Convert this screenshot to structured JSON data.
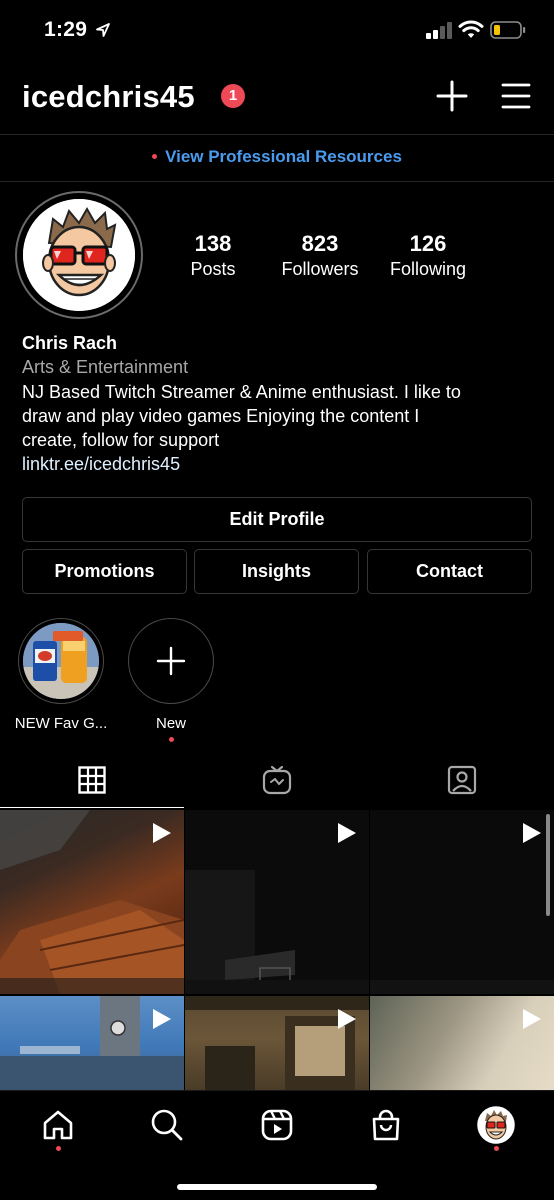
{
  "status_bar": {
    "time": "1:29",
    "icons": [
      "location-arrow-icon",
      "signal-icon",
      "wifi-icon",
      "battery-icon"
    ],
    "battery_color": "#f2c500"
  },
  "header": {
    "username": "icedchris45",
    "notification_count": "1",
    "icons": [
      "plus-icon",
      "menu-icon"
    ]
  },
  "pro_bar": {
    "label": "View Professional Resources",
    "link_color": "#4a9cf0"
  },
  "profile": {
    "stats": [
      {
        "value": "138",
        "label": "Posts"
      },
      {
        "value": "823",
        "label": "Followers"
      },
      {
        "value": "126",
        "label": "Following"
      }
    ],
    "name": "Chris Rach",
    "category": "Arts & Entertainment",
    "bio_lines": [
      "NJ Based Twitch Streamer & Anime enthusiast. I like to",
      "draw and play video games Enjoying the content I",
      "create, follow for support"
    ],
    "link": "linktr.ee/icedchris45"
  },
  "buttons": {
    "edit_profile": "Edit Profile",
    "promotions": "Promotions",
    "insights": "Insights",
    "contact": "Contact"
  },
  "highlights": [
    {
      "label": "NEW Fav G..."
    },
    {
      "label": "New"
    }
  ],
  "tabs": [
    "grid-icon",
    "igtv-icon",
    "tagged-icon"
  ],
  "grid_posts": [
    {
      "type": "video",
      "icon": "play-icon"
    },
    {
      "type": "video",
      "icon": "play-icon"
    },
    {
      "type": "video",
      "icon": "play-icon"
    },
    {
      "type": "video",
      "icon": "play-icon"
    },
    {
      "type": "video",
      "icon": "play-icon"
    },
    {
      "type": "video",
      "icon": "play-icon"
    }
  ],
  "bottom_nav": [
    "home-icon",
    "search-icon",
    "reels-icon",
    "shop-icon",
    "profile-avatar-icon"
  ],
  "accent_red": "#ed4956"
}
